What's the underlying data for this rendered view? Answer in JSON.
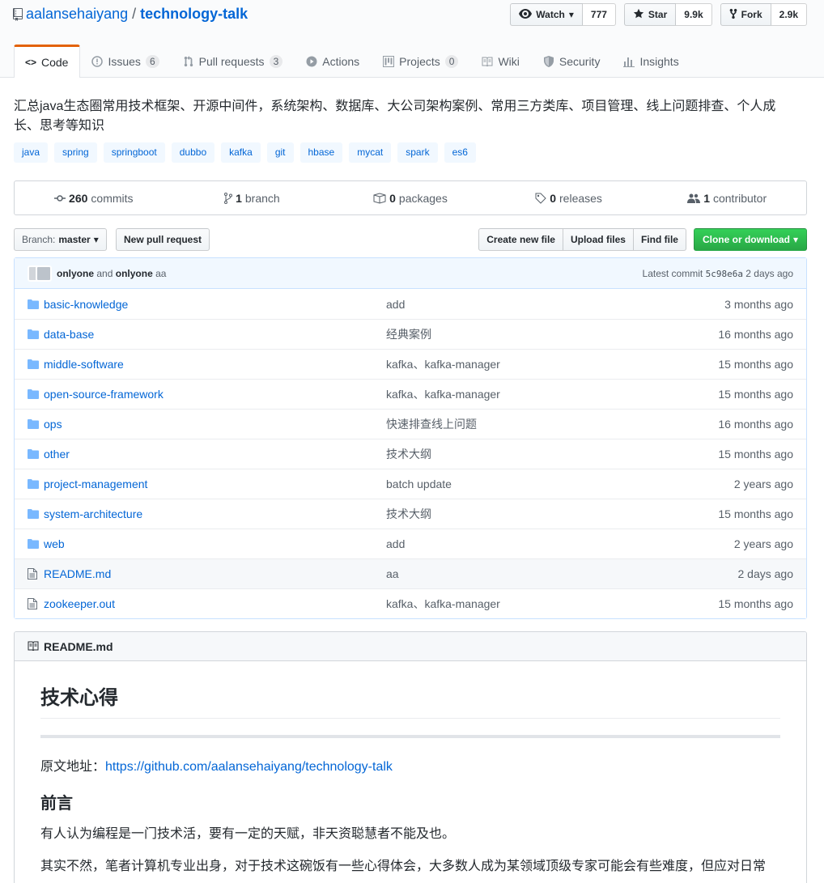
{
  "repo": {
    "owner": "aalansehaiyang",
    "separator": "/",
    "name": "technology-talk"
  },
  "actions": {
    "watch_label": "Watch",
    "watch_count": "777",
    "star_label": "Star",
    "star_count": "9.9k",
    "fork_label": "Fork",
    "fork_count": "2.9k"
  },
  "tabs": [
    {
      "label": "Code",
      "counter": ""
    },
    {
      "label": "Issues",
      "counter": "6"
    },
    {
      "label": "Pull requests",
      "counter": "3"
    },
    {
      "label": "Actions",
      "counter": ""
    },
    {
      "label": "Projects",
      "counter": "0"
    },
    {
      "label": "Wiki",
      "counter": ""
    },
    {
      "label": "Security",
      "counter": ""
    },
    {
      "label": "Insights",
      "counter": ""
    }
  ],
  "description": "汇总java生态圈常用技术框架、开源中间件，系统架构、数据库、大公司架构案例、常用三方类库、项目管理、线上问题排查、个人成长、思考等知识",
  "topics": [
    "java",
    "spring",
    "springboot",
    "dubbo",
    "kafka",
    "git",
    "hbase",
    "mycat",
    "spark",
    "es6"
  ],
  "summary": {
    "commits_count": "260",
    "commits_label": "commits",
    "branch_count": "1",
    "branch_label": "branch",
    "packages_count": "0",
    "packages_label": "packages",
    "releases_count": "0",
    "releases_label": "releases",
    "contributor_count": "1",
    "contributor_label": "contributor"
  },
  "filenav": {
    "branch_prefix": "Branch:",
    "branch_name": "master",
    "new_pr": "New pull request",
    "create_file": "Create new file",
    "upload_files": "Upload files",
    "find_file": "Find file",
    "clone": "Clone or download"
  },
  "commit": {
    "author1": "onlyone",
    "and": "and",
    "author2": "onlyone",
    "message": "aa",
    "latest_label": "Latest commit",
    "sha": "5c98e6a",
    "age": "2 days ago"
  },
  "files": [
    {
      "type": "dir",
      "name": "basic-knowledge",
      "message": "add",
      "age": "3 months ago"
    },
    {
      "type": "dir",
      "name": "data-base",
      "message": "经典案例",
      "age": "16 months ago"
    },
    {
      "type": "dir",
      "name": "middle-software",
      "message": "kafka、kafka-manager",
      "age": "15 months ago"
    },
    {
      "type": "dir",
      "name": "open-source-framework",
      "message": "kafka、kafka-manager",
      "age": "15 months ago"
    },
    {
      "type": "dir",
      "name": "ops",
      "message": "快速排查线上问题",
      "age": "16 months ago"
    },
    {
      "type": "dir",
      "name": "other",
      "message": "技术大纲",
      "age": "15 months ago"
    },
    {
      "type": "dir",
      "name": "project-management",
      "message": "batch update",
      "age": "2 years ago"
    },
    {
      "type": "dir",
      "name": "system-architecture",
      "message": "技术大纲",
      "age": "15 months ago"
    },
    {
      "type": "dir",
      "name": "web",
      "message": "add",
      "age": "2 years ago"
    },
    {
      "type": "file",
      "name": "README.md",
      "message": "aa",
      "age": "2 days ago"
    },
    {
      "type": "file",
      "name": "zookeeper.out",
      "message": "kafka、kafka-manager",
      "age": "15 months ago"
    }
  ],
  "readme": {
    "header": "README.md",
    "h1": "技术心得",
    "source_label": "原文地址：",
    "source_link": "https://github.com/aalansehaiyang/technology-talk",
    "h2": "前言",
    "p1": "有人认为编程是一门技术活，要有一定的天赋，非天资聪慧者不能及也。",
    "p2": "其实不然，笔者计算机专业出身，对于技术这碗饭有一些心得体会，大多数人成为某领域顶级专家可能会有些难度，但应对日常"
  },
  "colors": {
    "link": "#0366d6",
    "accent_tab": "#e36209",
    "green_button": "#28a745",
    "commit_bg": "#f1f8ff",
    "folder": "#79b8ff"
  }
}
